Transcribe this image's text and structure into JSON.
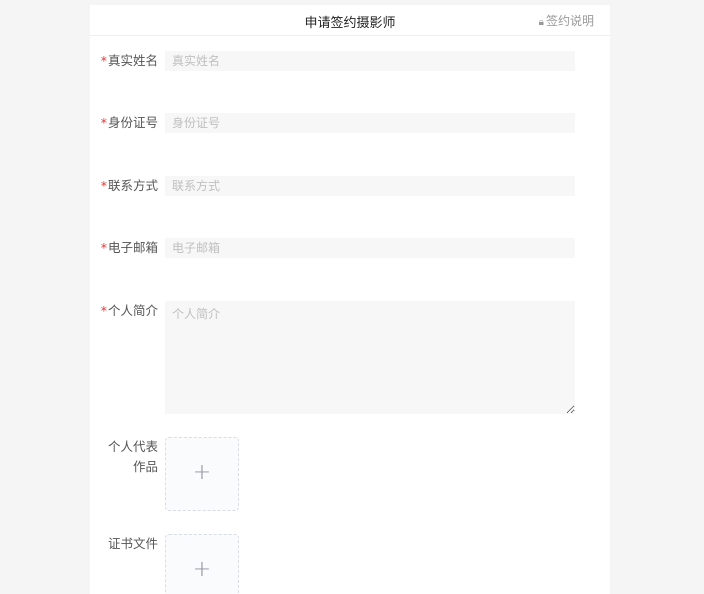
{
  "header": {
    "title": "申请签约摄影师",
    "link_label": "签约说明",
    "link_icon": "lock-icon"
  },
  "form": {
    "real_name": {
      "label": "真实姓名",
      "placeholder": "真实姓名",
      "required": true
    },
    "id_number": {
      "label": "身份证号",
      "placeholder": "身份证号",
      "required": true
    },
    "contact": {
      "label": "联系方式",
      "placeholder": "联系方式",
      "required": true
    },
    "email": {
      "label": "电子邮箱",
      "placeholder": "电子邮箱",
      "required": true
    },
    "bio": {
      "label": "个人简介",
      "placeholder": "个人简介",
      "required": true
    },
    "works": {
      "label": "个人代表作品",
      "upload_icon": "plus-icon"
    },
    "certificate": {
      "label": "证书文件",
      "upload_icon": "plus-icon"
    }
  },
  "colors": {
    "required_mark": "#ee3333",
    "input_bg": "#f7f7f7",
    "label": "#555555"
  }
}
